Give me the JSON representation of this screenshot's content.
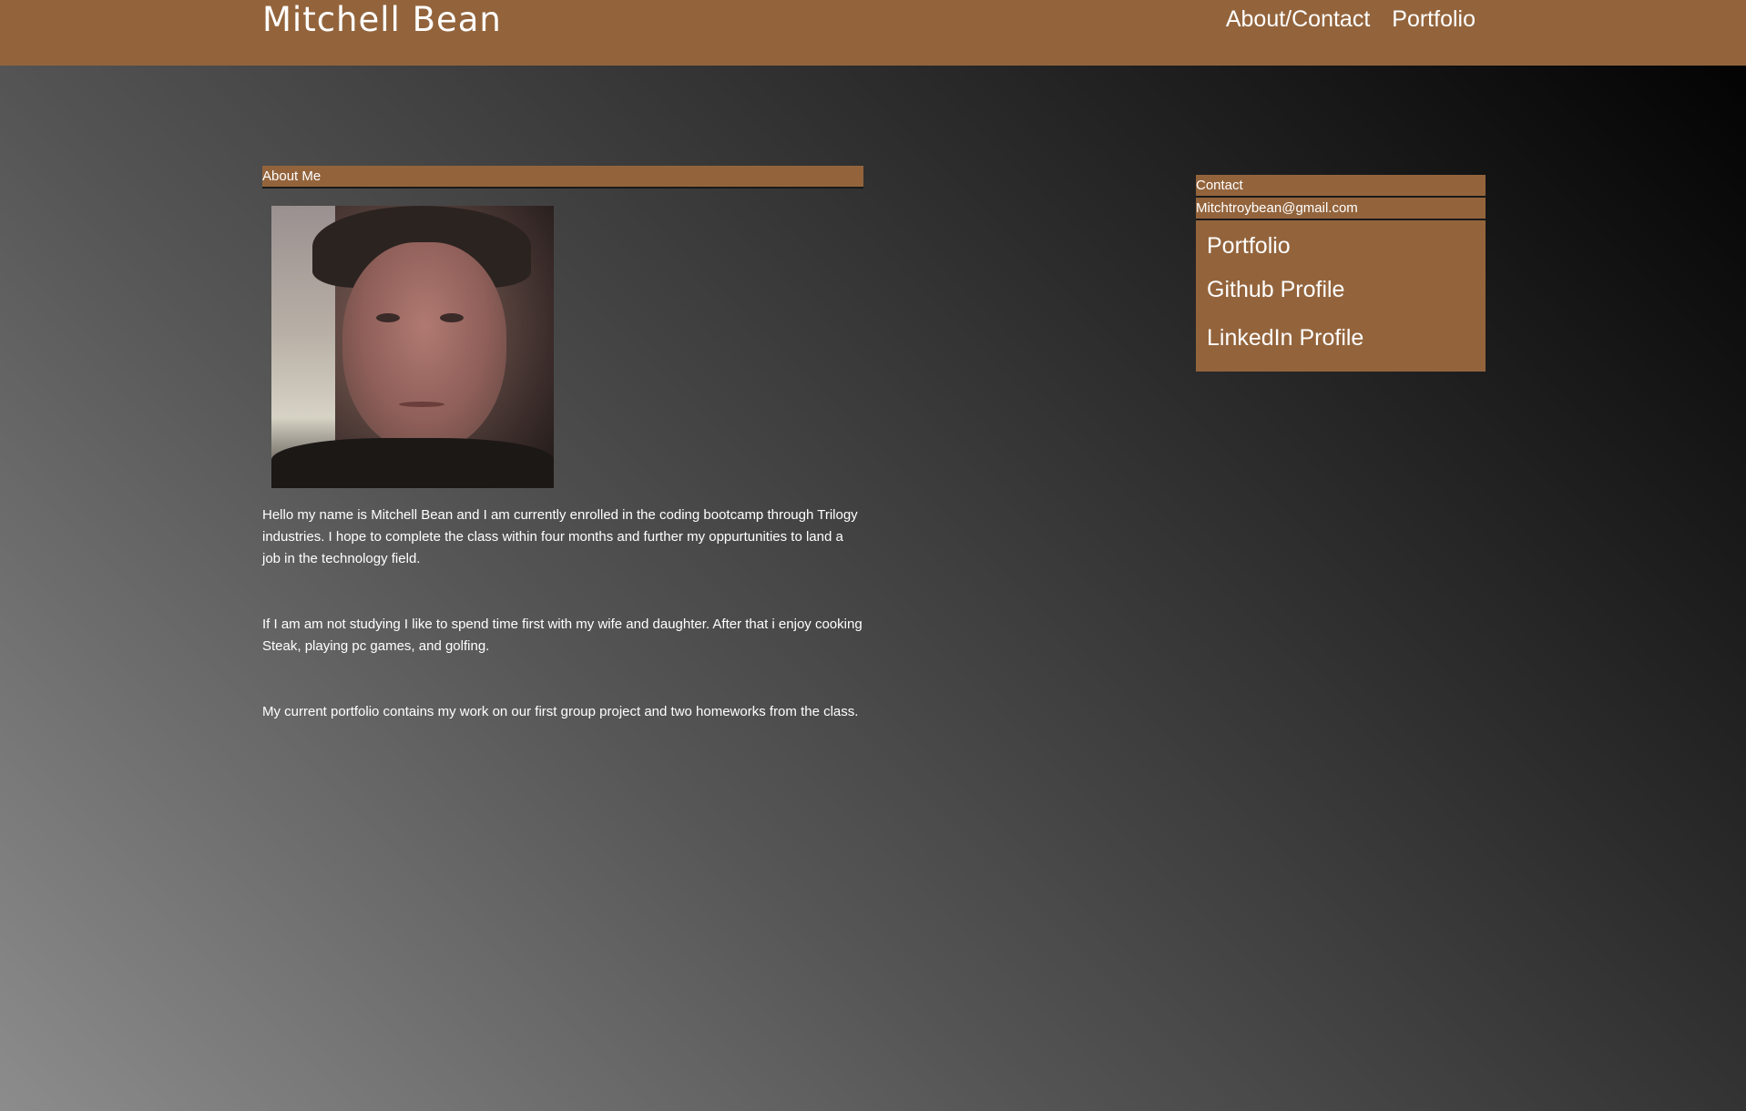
{
  "header": {
    "site_title": "Mitchell Bean",
    "nav": [
      {
        "label": "About/Contact"
      },
      {
        "label": "Portfolio"
      }
    ]
  },
  "about": {
    "heading": "About Me",
    "photo_icon": "profile-photo",
    "paragraphs": [
      "Hello my name is Mitchell Bean and I am currently enrolled in the coding bootcamp through Trilogy industries. I hope to complete the class within four months and further my oppurtunities to land a job in the technology field.",
      "If I am am not studying I like to spend time first with my wife and daughter. After that i enjoy cooking Steak, playing pc games, and golfing.",
      "My current portfolio contains my work on our first group project and two homeworks from the class."
    ]
  },
  "contact": {
    "heading": "Contact",
    "email": "Mitchtroybean@gmail.com",
    "links": [
      {
        "label": "Portfolio"
      },
      {
        "label": "Github Profile"
      },
      {
        "label": "LinkedIn Profile"
      }
    ]
  },
  "colors": {
    "accent": "#93643c",
    "text": "#ffffff"
  }
}
